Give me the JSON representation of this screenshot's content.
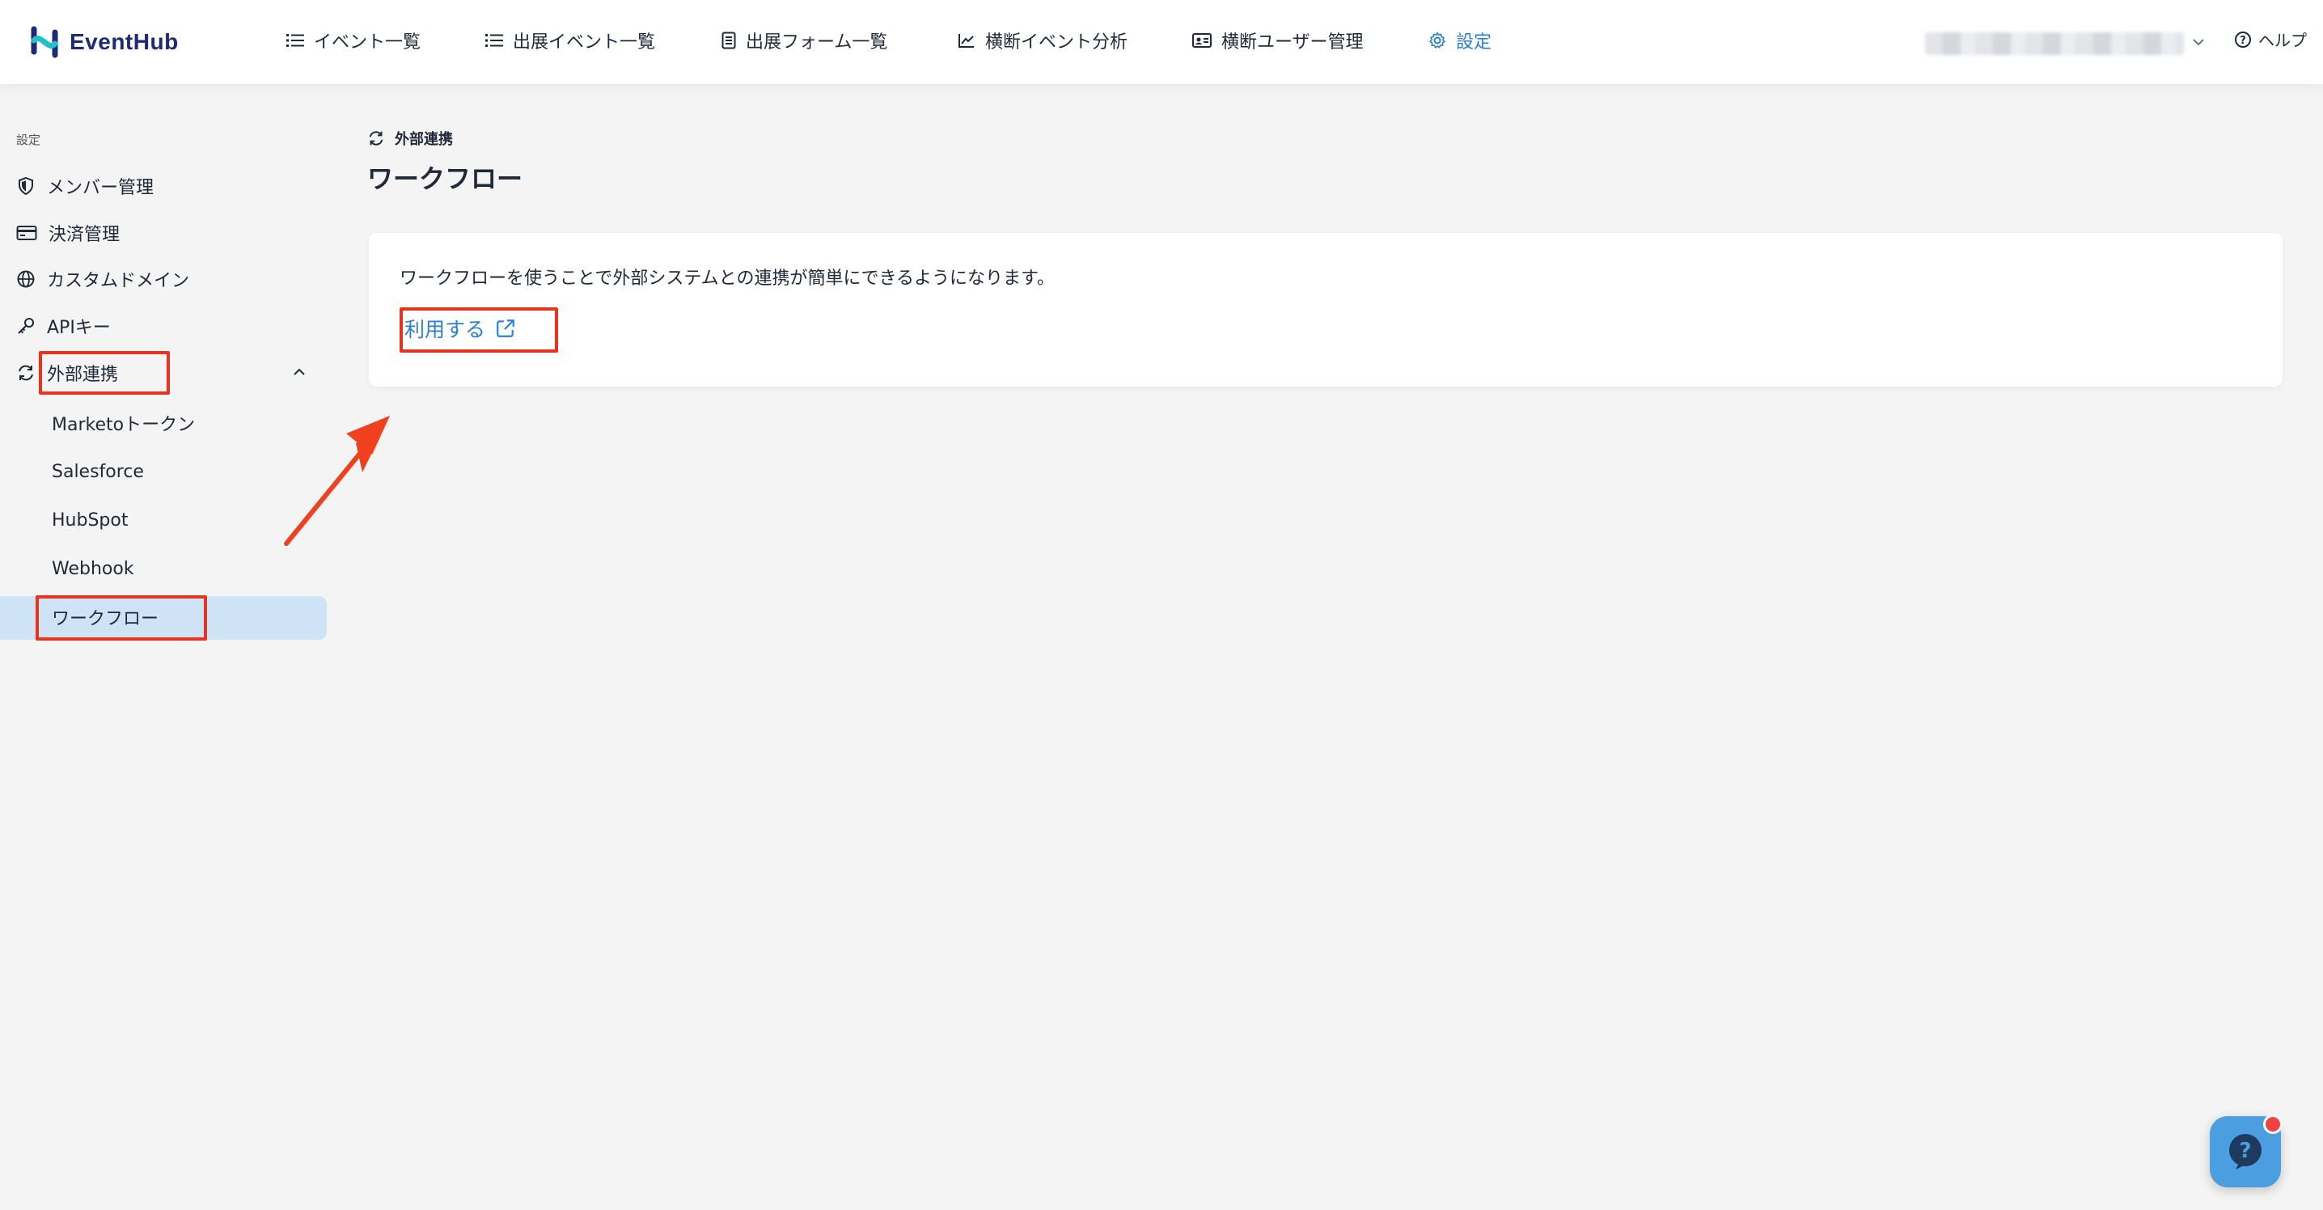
{
  "header": {
    "logo_text": "EventHub",
    "nav": [
      {
        "label": "イベント一覧",
        "icon": "list-icon"
      },
      {
        "label": "出展イベント一覧",
        "icon": "list-icon"
      },
      {
        "label": "出展フォーム一覧",
        "icon": "form-icon"
      },
      {
        "label": "横断イベント分析",
        "icon": "chart-line-icon"
      },
      {
        "label": "横断ユーザー管理",
        "icon": "id-card-icon"
      },
      {
        "label": "設定",
        "icon": "gear-icon",
        "active": true
      }
    ],
    "help_label": "ヘルプ"
  },
  "sidebar": {
    "section_label": "設定",
    "items": [
      {
        "label": "メンバー管理",
        "icon": "shield-icon"
      },
      {
        "label": "決済管理",
        "icon": "credit-card-icon"
      },
      {
        "label": "カスタムドメイン",
        "icon": "globe-icon"
      },
      {
        "label": "APIキー",
        "icon": "key-icon"
      },
      {
        "label": "外部連携",
        "icon": "sync-icon",
        "expanded": true
      }
    ],
    "sub_items": [
      {
        "label": "Marketoトークン"
      },
      {
        "label": "Salesforce"
      },
      {
        "label": "HubSpot"
      },
      {
        "label": "Webhook"
      },
      {
        "label": "ワークフロー",
        "active": true
      }
    ]
  },
  "main": {
    "breadcrumb": "外部連携",
    "title": "ワークフロー",
    "description": "ワークフローを使うことで外部システムとの連携が簡単にできるようになります。",
    "link_label": "利用する"
  },
  "colors": {
    "accent": "#2b7fd0",
    "highlight": "#e8341c",
    "active_bg": "#cfe3f6",
    "logo": "#1e2a78"
  }
}
